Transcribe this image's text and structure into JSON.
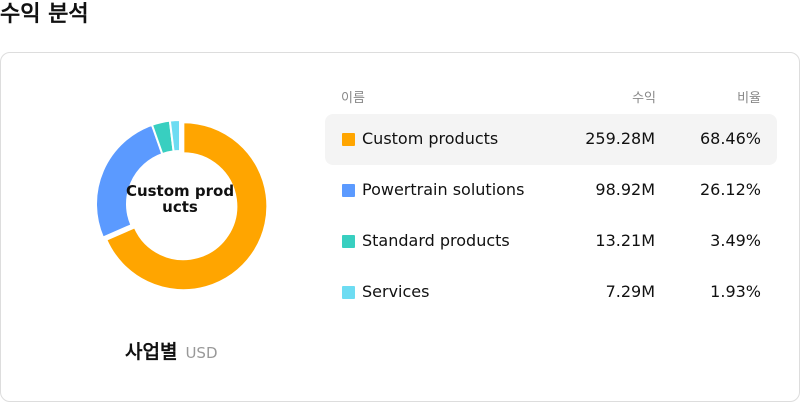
{
  "page": {
    "title": "수익 분석"
  },
  "chart_data": {
    "type": "pie",
    "variant": "donut",
    "center_label": "Custom products",
    "caption": "사업별",
    "unit": "USD",
    "columns": {
      "name": "이름",
      "revenue": "수익",
      "ratio": "비율"
    },
    "selected_index": 0,
    "series": [
      {
        "name": "Custom products",
        "value": 259.28,
        "value_label": "259.28M",
        "percent": 68.46,
        "percent_label": "68.46%",
        "color": "#ffa500"
      },
      {
        "name": "Powertrain solutions",
        "value": 98.92,
        "value_label": "98.92M",
        "percent": 26.12,
        "percent_label": "26.12%",
        "color": "#5b9aff"
      },
      {
        "name": "Standard products",
        "value": 13.21,
        "value_label": "13.21M",
        "percent": 3.49,
        "percent_label": "3.49%",
        "color": "#38cfc0"
      },
      {
        "name": "Services",
        "value": 7.29,
        "value_label": "7.29M",
        "percent": 1.93,
        "percent_label": "1.93%",
        "color": "#6ddcf2"
      }
    ]
  }
}
